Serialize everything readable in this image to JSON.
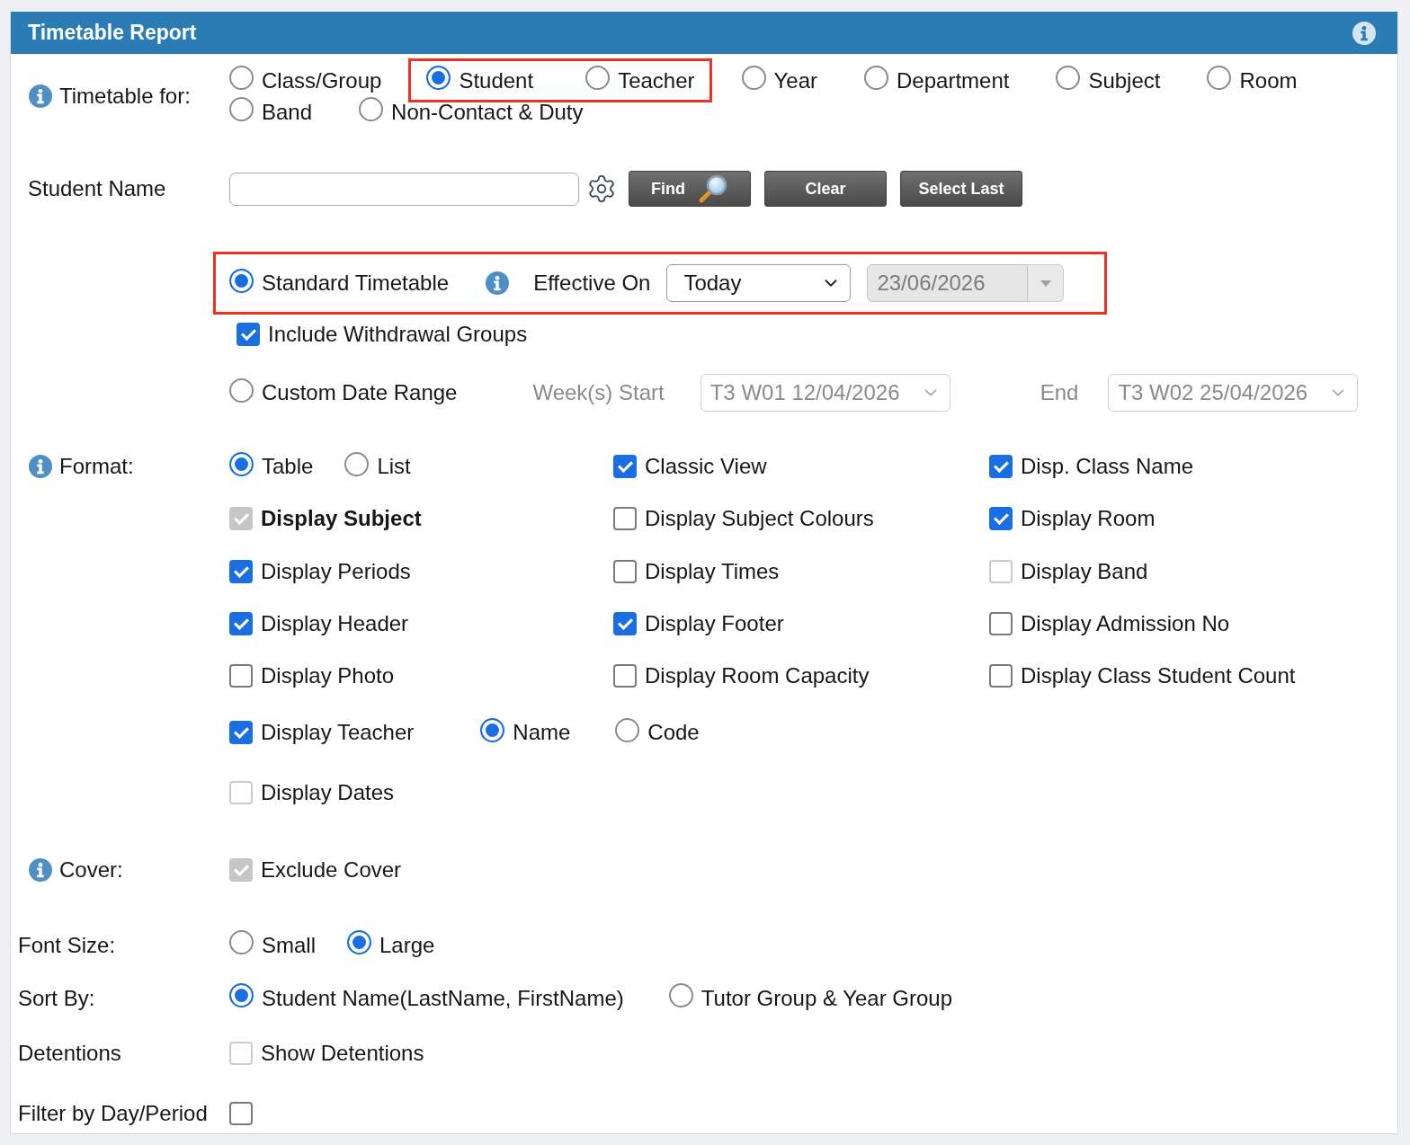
{
  "window": {
    "title": "Timetable Report"
  },
  "timetable_for": {
    "label": "Timetable for:",
    "info": true,
    "options": [
      {
        "label": "Class/Group",
        "selected": false,
        "highlighted": false
      },
      {
        "label": "Student",
        "selected": true,
        "highlighted": true
      },
      {
        "label": "Teacher",
        "selected": false,
        "highlighted": true
      },
      {
        "label": "Year",
        "selected": false,
        "highlighted": false
      },
      {
        "label": "Department",
        "selected": false,
        "highlighted": false
      },
      {
        "label": "Subject",
        "selected": false,
        "highlighted": false
      },
      {
        "label": "Room",
        "selected": false,
        "highlighted": false
      },
      {
        "label": "Band",
        "selected": false,
        "highlighted": false
      },
      {
        "label": "Non-Contact & Duty",
        "selected": false,
        "highlighted": false
      }
    ]
  },
  "student_name": {
    "label": "Student Name",
    "buttons": [
      {
        "kind": "search",
        "label": "Find"
      },
      {
        "kind": "plain",
        "label": "Clear"
      },
      {
        "kind": "plain",
        "label": "Select Last"
      }
    ]
  },
  "standard_timetable": {
    "label": "Standard Timetable",
    "selected": true,
    "highlighted": true,
    "effective_on_label": "Effective On",
    "effective_on": "Today",
    "date": {
      "value": "23/06/2026",
      "disabled": true
    }
  },
  "include_withdrawal_groups": {
    "label": "Include Withdrawal Groups",
    "checked": true
  },
  "custom_date_range": {
    "label": "Custom Date Range",
    "selected": false,
    "start_label": "Week(s) Start",
    "start": "T3 W01 12/04/2026",
    "end_label": "End",
    "end": "T3 W02 25/04/2026"
  },
  "format": {
    "label": "Format:",
    "info": true,
    "rows": [
      {
        "kind": "columns",
        "cells": [
          [
            {
              "kind": "radio",
              "label": "Table",
              "selected": true
            },
            {
              "kind": "radio",
              "label": "List",
              "selected": false
            }
          ],
          [
            {
              "kind": "checkbox",
              "label": "Classic View",
              "checked": true,
              "disabled": false,
              "emphasized": false
            }
          ],
          [
            {
              "kind": "checkbox",
              "label": "Disp. Class Name",
              "checked": true,
              "disabled": false,
              "emphasized": false
            }
          ]
        ]
      },
      {
        "kind": "columns",
        "cells": [
          [
            {
              "kind": "checkbox",
              "label": "Display Subject",
              "checked": true,
              "disabled": true,
              "emphasized": true
            }
          ],
          [
            {
              "kind": "checkbox",
              "label": "Display Subject Colours",
              "checked": false,
              "disabled": false,
              "emphasized": false
            }
          ],
          [
            {
              "kind": "checkbox",
              "label": "Display Room",
              "checked": true,
              "disabled": false,
              "emphasized": false
            }
          ]
        ]
      },
      {
        "kind": "columns",
        "cells": [
          [
            {
              "kind": "checkbox",
              "label": "Display Periods",
              "checked": true,
              "disabled": false,
              "emphasized": false
            }
          ],
          [
            {
              "kind": "checkbox",
              "label": "Display Times",
              "checked": false,
              "disabled": false,
              "emphasized": false
            }
          ],
          [
            {
              "kind": "checkbox",
              "label": "Display Band",
              "checked": false,
              "disabled": true,
              "emphasized": false
            }
          ]
        ]
      },
      {
        "kind": "columns",
        "cells": [
          [
            {
              "kind": "checkbox",
              "label": "Display Header",
              "checked": true,
              "disabled": false,
              "emphasized": false
            }
          ],
          [
            {
              "kind": "checkbox",
              "label": "Display Footer",
              "checked": true,
              "disabled": false,
              "emphasized": false
            }
          ],
          [
            {
              "kind": "checkbox",
              "label": "Display Admission No",
              "checked": false,
              "disabled": false,
              "emphasized": false
            }
          ]
        ]
      },
      {
        "kind": "columns",
        "cells": [
          [
            {
              "kind": "checkbox",
              "label": "Display Photo",
              "checked": false,
              "disabled": false,
              "emphasized": false
            }
          ],
          [
            {
              "kind": "checkbox",
              "label": "Display Room Capacity",
              "checked": false,
              "disabled": false,
              "emphasized": false
            }
          ],
          [
            {
              "kind": "checkbox",
              "label": "Display Class Student Count",
              "checked": false,
              "disabled": false,
              "emphasized": false
            }
          ]
        ]
      },
      {
        "kind": "inline",
        "cells": [
          [
            {
              "kind": "checkbox",
              "label": "Display Teacher",
              "checked": true,
              "disabled": false,
              "emphasized": false
            }
          ],
          [
            {
              "kind": "radio",
              "label": "Name",
              "selected": true
            },
            {
              "kind": "radio",
              "label": "Code",
              "selected": false
            }
          ]
        ]
      },
      {
        "kind": "inline",
        "cells": [
          [
            {
              "kind": "checkbox",
              "label": "Display Dates",
              "checked": false,
              "disabled": true,
              "emphasized": false
            }
          ]
        ]
      }
    ]
  },
  "cover": {
    "label": "Cover:",
    "info": true,
    "options": [
      {
        "kind": "checkbox",
        "label": "Exclude Cover",
        "checked": true,
        "disabled": true
      }
    ]
  },
  "font_size": {
    "label": "Font Size:",
    "options": [
      {
        "kind": "radio",
        "label": "Small",
        "selected": false
      },
      {
        "kind": "radio",
        "label": "Large",
        "selected": true
      }
    ]
  },
  "sort_by": {
    "label": "Sort By:",
    "options": [
      {
        "kind": "radio",
        "label": "Student Name(LastName, FirstName)",
        "selected": true
      },
      {
        "kind": "radio",
        "label": "Tutor Group & Year Group",
        "selected": false
      }
    ]
  },
  "detentions": {
    "label": "Detentions",
    "options": [
      {
        "kind": "checkbox",
        "label": "Show Detentions",
        "checked": false,
        "disabled": true
      }
    ]
  },
  "filter_by_day_period": {
    "label": "Filter by Day/Period",
    "options": [
      {
        "kind": "checkbox",
        "checked": false,
        "disabled": false
      }
    ]
  }
}
